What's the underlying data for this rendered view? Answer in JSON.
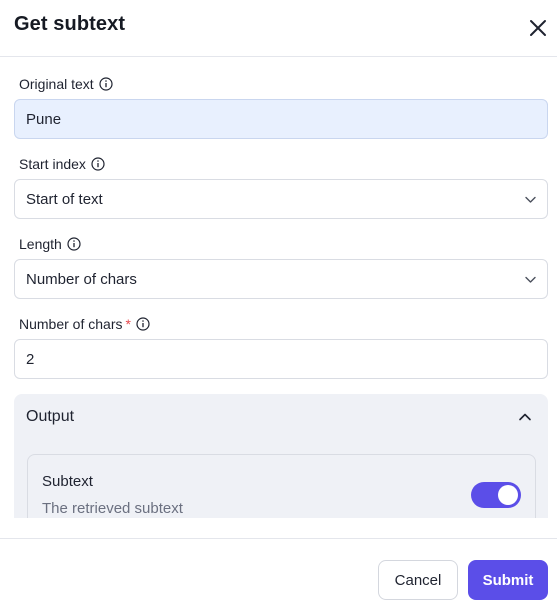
{
  "dialog": {
    "title": "Get subtext",
    "close_icon": "close-icon"
  },
  "fields": {
    "original_text": {
      "label": "Original text",
      "value": "Pune",
      "info_icon": "info-icon"
    },
    "start_index": {
      "label": "Start index",
      "value": "Start of text",
      "info_icon": "info-icon",
      "chevron_icon": "chevron-down-icon"
    },
    "length": {
      "label": "Length",
      "value": "Number of chars",
      "info_icon": "info-icon",
      "chevron_icon": "chevron-down-icon"
    },
    "number_of_chars": {
      "label": "Number of chars",
      "required_mark": "*",
      "value": "2",
      "info_icon": "info-icon"
    }
  },
  "output": {
    "title": "Output",
    "collapse_icon": "chevron-up-icon",
    "item": {
      "name": "Subtext",
      "description": "The retrieved subtext",
      "toggle_on": true
    }
  },
  "footer": {
    "cancel_label": "Cancel",
    "submit_label": "Submit"
  },
  "colors": {
    "accent": "#5b4ee8",
    "filled_input_bg": "#e8f0fe",
    "output_panel_bg": "#eff1f6",
    "required": "#e5484d"
  }
}
